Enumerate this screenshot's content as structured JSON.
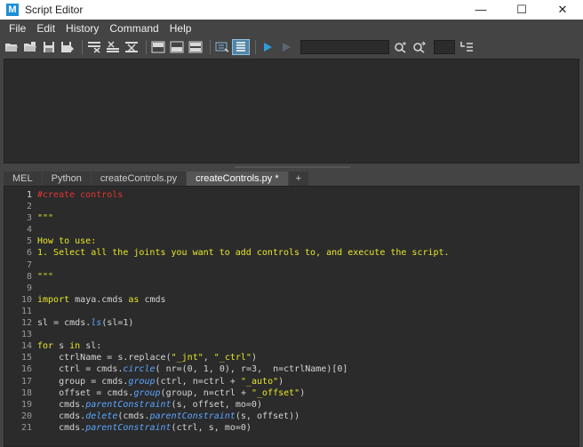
{
  "window": {
    "title": "Script Editor",
    "logo_letter": "M"
  },
  "window_controls": {
    "minimize": "—",
    "maximize": "☐",
    "close": "✕"
  },
  "menu": [
    "File",
    "Edit",
    "History",
    "Command",
    "Help"
  ],
  "toolbar": {
    "search_value": "",
    "icons": [
      "open-script-icon",
      "source-script-icon",
      "save-script-icon",
      "save-to-shelf-icon",
      "clear-history-icon",
      "clear-input-icon",
      "clear-all-icon",
      "show-history-icon",
      "show-input-icon",
      "show-both-icon",
      "echo-all-commands-icon",
      "show-line-numbers-icon",
      "execute-all-icon",
      "execute-selected-icon",
      "search-icon",
      "search-next-icon",
      "goto-line-icon"
    ]
  },
  "tabs": [
    {
      "label": "MEL",
      "active": false
    },
    {
      "label": "Python",
      "active": false
    },
    {
      "label": "createControls.py",
      "active": false
    },
    {
      "label": "createControls.py *",
      "active": true
    },
    {
      "label": "+",
      "active": false
    }
  ],
  "code": {
    "lines": [
      {
        "n": "1",
        "text": "#create controls"
      },
      {
        "n": "2",
        "text": ""
      },
      {
        "n": "3",
        "text": "\"\"\""
      },
      {
        "n": "4",
        "text": ""
      },
      {
        "n": "5",
        "text": "How to use:"
      },
      {
        "n": "6",
        "text": "1. Select all the joints you want to add controls to, and execute the script."
      },
      {
        "n": "7",
        "text": ""
      },
      {
        "n": "8",
        "text": "\"\"\""
      },
      {
        "n": "9",
        "text": ""
      },
      {
        "n": "10",
        "text": "import maya.cmds as cmds"
      },
      {
        "n": "11",
        "text": ""
      },
      {
        "n": "12",
        "text": "sl = cmds.ls(sl=1)"
      },
      {
        "n": "13",
        "text": ""
      },
      {
        "n": "14",
        "text": "for s in sl:"
      },
      {
        "n": "15",
        "text": "    ctrlName = s.replace(\"_jnt\", \"_ctrl\")"
      },
      {
        "n": "16",
        "text": "    ctrl = cmds.circle( nr=(0, 1, 0), r=3,  n=ctrlName)[0]"
      },
      {
        "n": "17",
        "text": "    group = cmds.group(ctrl, n=ctrl + \"_auto\")"
      },
      {
        "n": "18",
        "text": "    offset = cmds.group(group, n=ctrl + \"_offset\")"
      },
      {
        "n": "19",
        "text": "    cmds.parentConstraint(s, offset, mo=0)"
      },
      {
        "n": "20",
        "text": "    cmds.delete(cmds.parentConstraint(s, offset))"
      },
      {
        "n": "21",
        "text": "    cmds.parentConstraint(ctrl, s, mo=0)"
      }
    ]
  },
  "colors": {
    "comment": "#e33535",
    "string": "#e6e62a",
    "keyword": "#e6e62a",
    "function": "#5aa6ff",
    "plain": "#d4d4d4",
    "background": "#2b2b2b",
    "accent": "#5285a6"
  }
}
